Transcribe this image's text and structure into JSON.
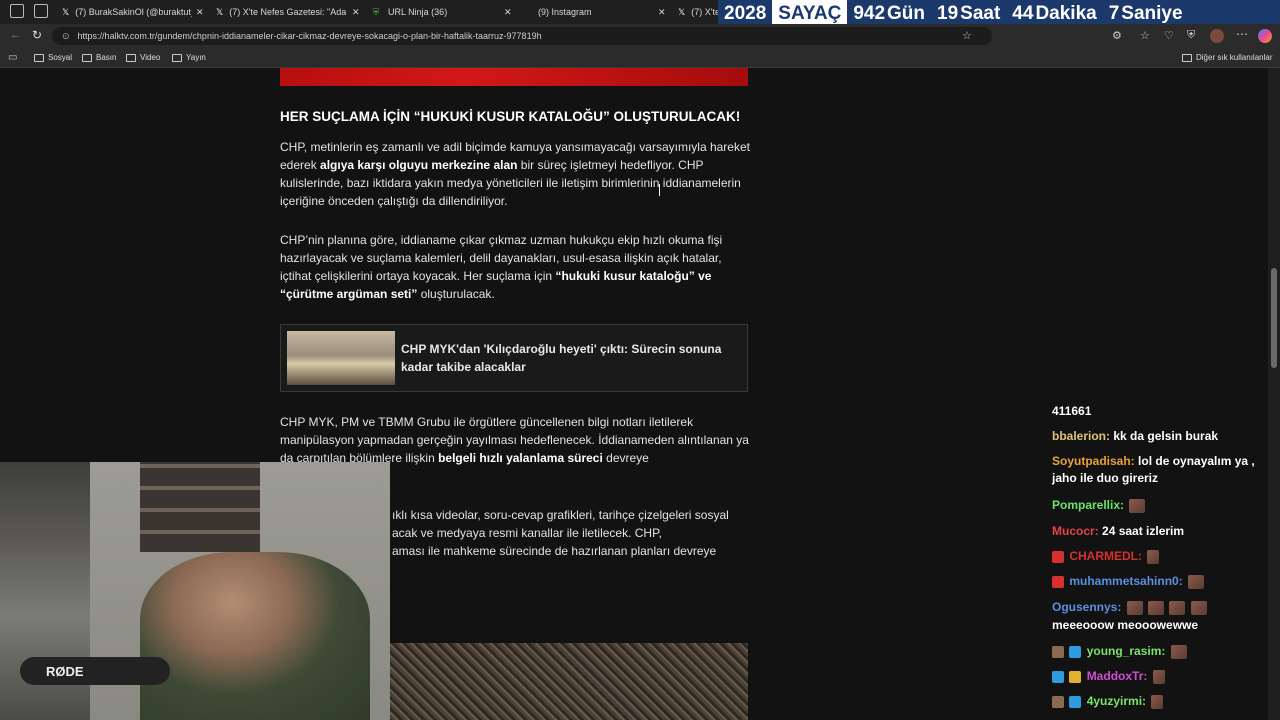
{
  "tabs": [
    {
      "label": "(7) BurakSakinOl (@buraktut_) /",
      "icon": "x-icon"
    },
    {
      "label": "(7) X'te Nefes Gazetesi: \"Adana\"",
      "icon": "x-icon"
    },
    {
      "label": "URL Ninja (36)",
      "icon": "shield-icon"
    },
    {
      "label": "(9) Instagram",
      "icon": "instagram-icon"
    },
    {
      "label": "(7) X'te",
      "icon": "x-icon"
    }
  ],
  "counter": {
    "year": "2028",
    "label": "SAYAÇ",
    "days_value": "942",
    "days_unit": "Gün",
    "hours_value": "19",
    "hours_unit": "Saat",
    "minutes_value": "44",
    "minutes_unit": "Dakika",
    "seconds_value": "7",
    "seconds_unit": "Saniye"
  },
  "url": "https://halktv.com.tr/gundem/chpnin-iddianameler-cikar-cikmaz-devreye-sokacagi-o-plan-bir-haftalik-taarruz-977819h",
  "bookmarks": [
    "Sosyal",
    "Basın",
    "Video",
    "Yayın"
  ],
  "bookmarks_other": "Diğer sık kullanılanlar",
  "article": {
    "heading": "HER SUÇLAMA İÇİN “HUKUKİ KUSUR KATALOĞU” OLUŞTURULACAK!",
    "p1_a": "CHP, metinlerin eş zamanlı ve adil biçimde kamuya yansımayacağı varsayımıyla hareket ederek ",
    "p1_b": "algıya karşı olguyu merkezine alan",
    "p1_c": " bir süreç işletmeyi hedefliyor. CHP kulislerinde, bazı iktidara yakın medya yöneticileri ile iletişim birimlerinin iddianamelerin içeriğine önceden çalıştığı da dillendiriliyor.",
    "p2_a": "CHP’nin planına göre, iddianame çıkar çıkmaz uzman hukukçu ekip hızlı okuma fişi hazırlayacak ve suçlama kalemleri, delil dayanakları, usul-esasa ilişkin açık hatalar, içtihat çelişkilerini ortaya koyacak. Her suçlama için ",
    "p2_b": "“hukuki kusur kataloğu” ve “çürütme argüman seti”",
    "p2_c": " oluşturulacak.",
    "related_title": "CHP MYK'dan 'Kılıçdaroğlu heyeti' çıktı: Sürecin sonuna kadar takibe alacaklar",
    "p3_a": "CHP MYK, PM ve TBMM Grubu ile örgütlere güncellenen bilgi notları iletilerek manipülasyon yapmadan gerçeğin yayılması hedeflenecek. İddianameden alıntılanan ya da çarpıtılan bölümlere ilişkin ",
    "p3_b": "belgeli hızlı yalanlama süreci",
    "p3_c": " devreye",
    "p4_l1": "ıklı kısa videolar, soru-cevap grafikleri, tarihçe çizelgeleri sosyal",
    "p4_l2": "acak ve medyaya resmi kanallar ile iletilecek. CHP,",
    "p4_l3": "aması ile mahkeme sürecinde de hazırlanan planları devreye"
  },
  "webcam_brand": "RØDE",
  "chat": {
    "count": "411661",
    "messages": [
      {
        "user": "bbalerion:",
        "color": "#e0c27a",
        "text": "kk da gelsin burak"
      },
      {
        "user": "Soyutpadisah:",
        "color": "#e8a33a",
        "text": "lol de oynayalım ya , jaho ile duo gireriz"
      },
      {
        "user": "Pomparellix:",
        "color": "#6be36b",
        "text": ""
      },
      {
        "user": "Mucocr:",
        "color": "#e04848",
        "text": "24 saat izlerim"
      },
      {
        "user": "CHARMEDL:",
        "color": "#d63030",
        "text": ""
      },
      {
        "user": "muhammetsahinn0:",
        "color": "#5b8fe0",
        "text": ""
      },
      {
        "user": "Ogusennys:",
        "color": "#5b8fe0",
        "text": ""
      },
      {
        "user": "",
        "color": "#ffffff",
        "text": "meeeooow   meooowewwe"
      },
      {
        "user": "young_rasim:",
        "color": "#7be36b",
        "text": ""
      },
      {
        "user": "MaddoxTr:",
        "color": "#d04fd0",
        "text": ""
      },
      {
        "user": "4yuzyirmi:",
        "color": "#7be36b",
        "text": ""
      }
    ]
  }
}
